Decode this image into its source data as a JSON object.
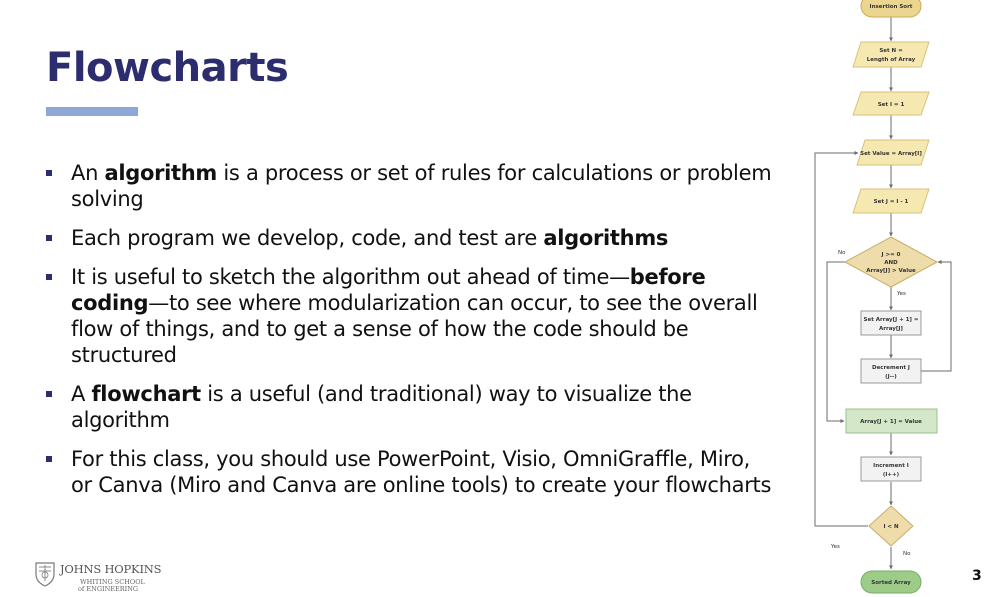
{
  "slide": {
    "title": "Flowcharts",
    "page_number": "3",
    "bullets": [
      {
        "parts": [
          {
            "t": "An ",
            "b": false
          },
          {
            "t": "algorithm",
            "b": true
          },
          {
            "t": " is a process or set of rules for calculations or problem solving",
            "b": false
          }
        ]
      },
      {
        "parts": [
          {
            "t": "Each program we develop, code, and test are ",
            "b": false
          },
          {
            "t": "algorithms",
            "b": true
          }
        ]
      },
      {
        "parts": [
          {
            "t": "It is useful to sketch the algorithm out ahead of time—",
            "b": false
          },
          {
            "t": "before coding",
            "b": true
          },
          {
            "t": "—to see where modularization can occur, to see the overall flow of things, and to get a sense of how the code should be structured",
            "b": false
          }
        ]
      },
      {
        "parts": [
          {
            "t": "A ",
            "b": false
          },
          {
            "t": "flowchart",
            "b": true
          },
          {
            "t": " is a useful (and traditional) way to visualize the algorithm",
            "b": false
          }
        ]
      },
      {
        "parts": [
          {
            "t": "For this class, you should use PowerPoint, Visio, OmniGraffle, Miro, or Canva (Miro and Canva are online tools) to create your flowcharts",
            "b": false
          }
        ]
      }
    ]
  },
  "logo": {
    "line1": "JOHNS HOPKINS",
    "line2": "WHITING SCHOOL",
    "line3": "of ENGINEERING"
  },
  "flowchart": {
    "colors": {
      "terminal_fill": "#ebd58f",
      "terminal_stroke": "#c9ad5a",
      "io_fill": "#f6e8b1",
      "io_stroke": "#d8c27a",
      "decision_fill": "#efdcab",
      "decision_stroke": "#c9ad6a",
      "process_fill": "#f2f2f2",
      "process_stroke": "#999999",
      "assign_fill": "#d4e8c9",
      "assign_stroke": "#9cbf8a",
      "end_fill": "#9dcc88",
      "end_stroke": "#7bab66",
      "line": "#6b6b6b"
    },
    "nodes": {
      "start": "Insertion Sort",
      "set_n_1": "Set N =",
      "set_n_2": "Length of Array",
      "set_i": "Set I = 1",
      "set_value": "Set Value = Array[I]",
      "set_j": "Set J = I - 1",
      "cond_1": "J >= 0",
      "cond_2": "AND",
      "cond_3": "Array[J] > Value",
      "shift_1": "Set Array[J + 1] =",
      "shift_2": "Array[J]",
      "dec_1": "Decrement J",
      "dec_2": "(J--)",
      "assign": "Array[J + 1] = Value",
      "inc_1": "Increment I",
      "inc_2": "(I++)",
      "loop_cond": "I < N",
      "end": "Sorted Array"
    },
    "edge_labels": {
      "cond_no": "No",
      "cond_yes": "Yes",
      "loop_yes": "Yes",
      "loop_no": "No"
    }
  }
}
